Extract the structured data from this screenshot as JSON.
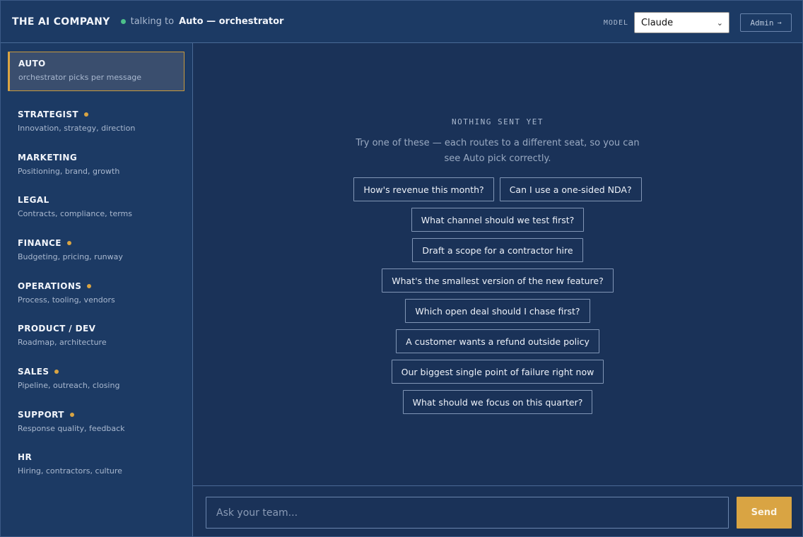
{
  "header": {
    "brand": "THE AI COMPANY",
    "talking_to_label": "talking to",
    "talking_to_target": "Auto — orchestrator",
    "model_label": "MODEL",
    "model_selected": "Claude",
    "admin_label": "Admin",
    "status_color": "#4cc08a"
  },
  "sidebar": {
    "items": [
      {
        "name": "AUTO",
        "desc": "orchestrator picks per message",
        "active": true,
        "dot": false
      },
      {
        "name": "STRATEGIST",
        "desc": "Innovation, strategy, direction",
        "active": false,
        "dot": true
      },
      {
        "name": "MARKETING",
        "desc": "Positioning, brand, growth",
        "active": false,
        "dot": false
      },
      {
        "name": "LEGAL",
        "desc": "Contracts, compliance, terms",
        "active": false,
        "dot": false
      },
      {
        "name": "FINANCE",
        "desc": "Budgeting, pricing, runway",
        "active": false,
        "dot": true
      },
      {
        "name": "OPERATIONS",
        "desc": "Process, tooling, vendors",
        "active": false,
        "dot": true
      },
      {
        "name": "PRODUCT / DEV",
        "desc": "Roadmap, architecture",
        "active": false,
        "dot": false
      },
      {
        "name": "SALES",
        "desc": "Pipeline, outreach, closing",
        "active": false,
        "dot": true
      },
      {
        "name": "SUPPORT",
        "desc": "Response quality, feedback",
        "active": false,
        "dot": true
      },
      {
        "name": "HR",
        "desc": "Hiring, contractors, culture",
        "active": false,
        "dot": false
      }
    ]
  },
  "main": {
    "empty_title": "NOTHING SENT YET",
    "empty_hint": "Try one of these — each routes to a different seat, so you can see Auto pick correctly.",
    "suggestions": [
      "How's revenue this month?",
      "Can I use a one-sided NDA?",
      "What channel should we test first?",
      "Draft a scope for a contractor hire",
      "What's the smallest version of the new feature?",
      "Which open deal should I chase first?",
      "A customer wants a refund outside policy",
      "Our biggest single point of failure right now",
      "What should we focus on this quarter?"
    ]
  },
  "composer": {
    "placeholder": "Ask your team...",
    "send_label": "Send",
    "accent_color": "#d9a443"
  }
}
